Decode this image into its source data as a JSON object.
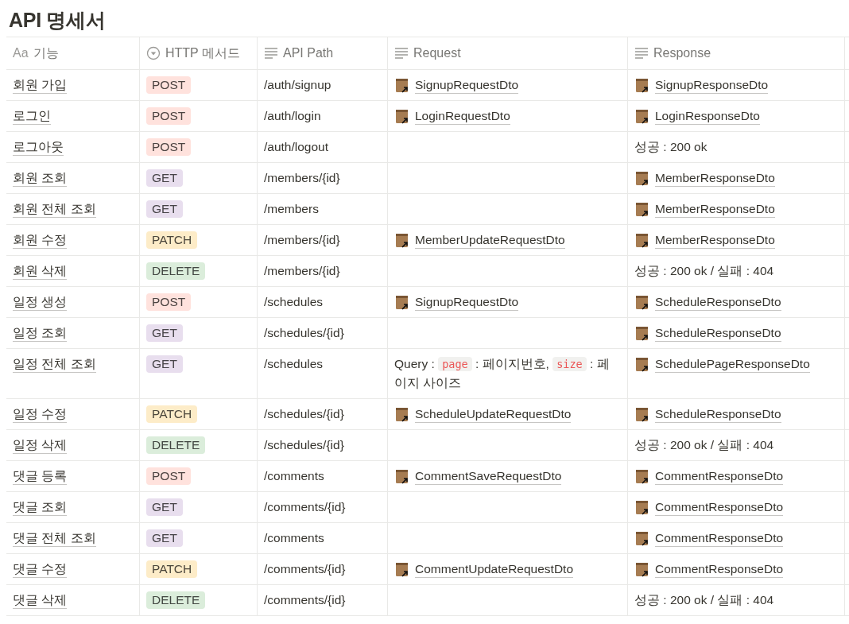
{
  "title": "API 명세서",
  "columns": [
    {
      "kind": "title",
      "glyph": "Aa",
      "label": "기능"
    },
    {
      "kind": "select",
      "label": "HTTP 메서드"
    },
    {
      "kind": "text",
      "label": "API Path"
    },
    {
      "kind": "text",
      "label": "Request"
    },
    {
      "kind": "text",
      "label": "Response"
    }
  ],
  "rows": [
    {
      "name": "회원 가입",
      "method": {
        "label": "POST",
        "color": "#ffe2dd"
      },
      "path": "/auth/signup",
      "request": {
        "kind": "link",
        "text": "SignupRequestDto"
      },
      "response": {
        "kind": "link",
        "text": "SignupResponseDto"
      }
    },
    {
      "name": "로그인",
      "method": {
        "label": "POST",
        "color": "#ffe2dd"
      },
      "path": "/auth/login",
      "request": {
        "kind": "link",
        "text": "LoginRequestDto"
      },
      "response": {
        "kind": "link",
        "text": "LoginResponseDto"
      }
    },
    {
      "name": "로그아웃",
      "method": {
        "label": "POST",
        "color": "#ffe2dd"
      },
      "path": "/auth/logout",
      "response": {
        "kind": "text",
        "text": "성공 : 200 ok"
      }
    },
    {
      "name": "회원 조회",
      "method": {
        "label": "GET",
        "color": "#e8deee"
      },
      "path": "/members/{id}",
      "response": {
        "kind": "link",
        "text": "MemberResponseDto"
      }
    },
    {
      "name": "회원 전체 조회",
      "method": {
        "label": "GET",
        "color": "#e8deee"
      },
      "path": "/members",
      "response": {
        "kind": "link",
        "text": "MemberResponseDto"
      }
    },
    {
      "name": "회원 수정",
      "method": {
        "label": "PATCH",
        "color": "#fdecc8"
      },
      "path": "/members/{id}",
      "request": {
        "kind": "link",
        "text": "MemberUpdateRequestDto"
      },
      "response": {
        "kind": "link",
        "text": "MemberResponseDto"
      }
    },
    {
      "name": "회원 삭제",
      "method": {
        "label": "DELETE",
        "color": "#dbeddb"
      },
      "path": "/members/{id}",
      "response": {
        "kind": "text",
        "text": "성공 : 200 ok / 실패 : 404"
      }
    },
    {
      "name": "일정 생성",
      "method": {
        "label": "POST",
        "color": "#ffe2dd"
      },
      "path": "/schedules",
      "request": {
        "kind": "link",
        "text": "SignupRequestDto"
      },
      "response": {
        "kind": "link",
        "text": "ScheduleResponseDto"
      }
    },
    {
      "name": "일정 조회",
      "method": {
        "label": "GET",
        "color": "#e8deee"
      },
      "path": "/schedules/{id}",
      "response": {
        "kind": "link",
        "text": "ScheduleResponseDto"
      }
    },
    {
      "name": "일정 전체 조회",
      "method": {
        "label": "GET",
        "color": "#e8deee"
      },
      "path": "/schedules",
      "request": {
        "kind": "rich",
        "parts": [
          {
            "kind": "plain",
            "text": "Query : "
          },
          {
            "kind": "code",
            "text": "page"
          },
          {
            "kind": "plain",
            "text": " : 페이지번호, "
          },
          {
            "kind": "code",
            "text": "size"
          },
          {
            "kind": "plain",
            "text": " : 페이지 사이즈"
          }
        ]
      },
      "response": {
        "kind": "link",
        "text": "SchedulePageResponseDto"
      }
    },
    {
      "name": "일정 수정",
      "method": {
        "label": "PATCH",
        "color": "#fdecc8"
      },
      "path": "/schedules/{id}",
      "request": {
        "kind": "link",
        "text": "ScheduleUpdateRequestDto"
      },
      "response": {
        "kind": "link",
        "text": "ScheduleResponseDto"
      }
    },
    {
      "name": "일정 삭제",
      "method": {
        "label": "DELETE",
        "color": "#dbeddb"
      },
      "path": "/schedules/{id}",
      "response": {
        "kind": "text",
        "text": "성공 : 200 ok / 실패 : 404"
      }
    },
    {
      "name": "댓글 등록",
      "method": {
        "label": "POST",
        "color": "#ffe2dd"
      },
      "path": "/comments",
      "request": {
        "kind": "link",
        "text": "CommentSaveRequestDto"
      },
      "response": {
        "kind": "link",
        "text": "CommentResponseDto"
      }
    },
    {
      "name": "댓글 조회",
      "method": {
        "label": "GET",
        "color": "#e8deee"
      },
      "path": "/comments/{id}",
      "response": {
        "kind": "link",
        "text": "CommentResponseDto"
      }
    },
    {
      "name": "댓글 전체 조회",
      "method": {
        "label": "GET",
        "color": "#e8deee"
      },
      "path": "/comments",
      "response": {
        "kind": "link",
        "text": "CommentResponseDto"
      }
    },
    {
      "name": "댓글 수정",
      "method": {
        "label": "PATCH",
        "color": "#fdecc8"
      },
      "path": "/comments/{id}",
      "request": {
        "kind": "link",
        "text": "CommentUpdateRequestDto"
      },
      "response": {
        "kind": "link",
        "text": "CommentResponseDto"
      }
    },
    {
      "name": "댓글 삭제",
      "method": {
        "label": "DELETE",
        "color": "#dbeddb"
      },
      "path": "/comments/{id}",
      "response": {
        "kind": "text",
        "text": "성공 : 200 ok / 실패 : 404"
      }
    }
  ]
}
